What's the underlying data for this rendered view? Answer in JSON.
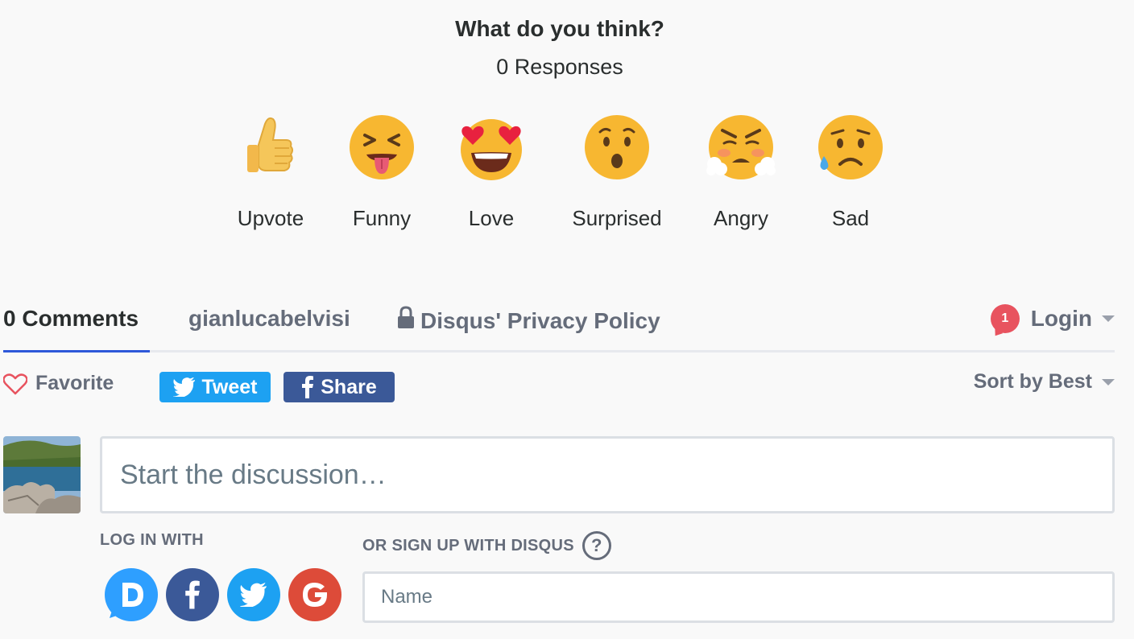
{
  "header": {
    "title": "What do you think?",
    "responses": "0 Responses"
  },
  "reactions": [
    {
      "label": "Upvote",
      "icon": "thumbs-up-icon"
    },
    {
      "label": "Funny",
      "icon": "tongue-out-face-icon"
    },
    {
      "label": "Love",
      "icon": "heart-eyes-face-icon"
    },
    {
      "label": "Surprised",
      "icon": "surprised-face-icon"
    },
    {
      "label": "Angry",
      "icon": "angry-steam-face-icon"
    },
    {
      "label": "Sad",
      "icon": "sad-sweat-face-icon"
    }
  ],
  "tabs": {
    "comments": "0 Comments",
    "community": "gianlucabelvisi",
    "privacy": "Disqus' Privacy Policy",
    "notification_count": "1",
    "login": "Login"
  },
  "actions": {
    "favorite": "Favorite",
    "tweet": "Tweet",
    "share": "Share",
    "sort": "Sort by Best"
  },
  "composer": {
    "placeholder": "Start the discussion…"
  },
  "auth": {
    "login_with": "LOG IN WITH",
    "signup": "OR SIGN UP WITH DISQUS",
    "help": "?",
    "name_placeholder": "Name",
    "providers": [
      {
        "name": "disqus",
        "color": "#2e9fff"
      },
      {
        "name": "facebook",
        "color": "#3b5998"
      },
      {
        "name": "twitter",
        "color": "#1da1f2"
      },
      {
        "name": "google",
        "color": "#dd4b39"
      }
    ]
  },
  "colors": {
    "accent": "#2e58d9",
    "notification": "#e8535f",
    "text_muted": "#656c7a"
  }
}
